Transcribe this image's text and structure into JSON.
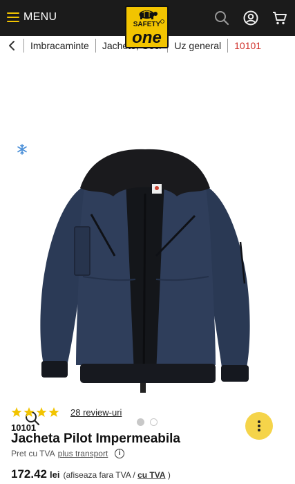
{
  "header": {
    "menu_label": "MENU",
    "logo_line1": "SAFETY",
    "logo_line2": "one",
    "accent": "#f2c400",
    "bar_color": "#1b1b1b"
  },
  "breadcrumb": {
    "items": [
      "Imbracaminte",
      "Jachete, Geci",
      "Uz general",
      "10101"
    ],
    "active_color": "#d0302a"
  },
  "gallery": {
    "brand_tag": "safetyone",
    "image_count": 2,
    "active_index": 0
  },
  "product": {
    "rating": 4,
    "reviews_label": "28 review-uri",
    "sku": "10101",
    "title": "Jacheta Pilot Impermeabila",
    "vat_label": "Pret cu TVA",
    "transport_label": "plus transport",
    "price": "172.42",
    "currency": "lei",
    "price_note_prefix": "(afiseaza fara TVA /",
    "price_note_link": "cu TVA",
    "price_note_suffix": ")"
  }
}
